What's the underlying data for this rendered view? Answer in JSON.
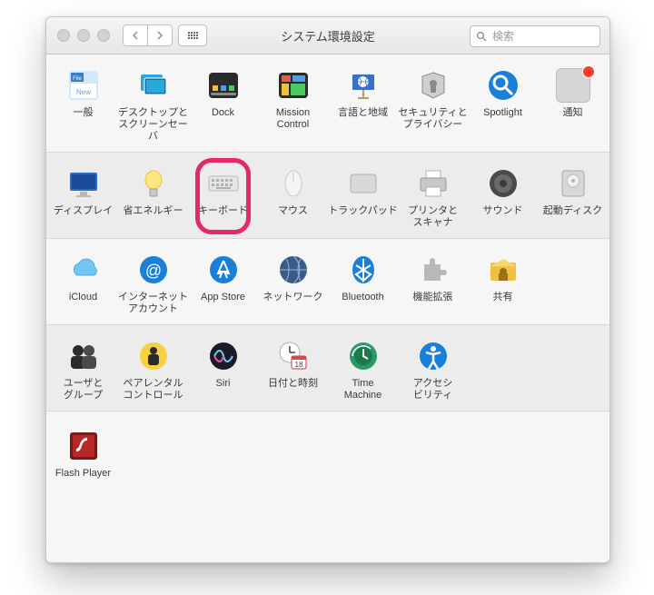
{
  "window": {
    "title": "システム環境設定",
    "search_placeholder": "検索"
  },
  "highlight": {
    "pane": "keyboard",
    "color": "#e6276b"
  },
  "rows": [
    [
      {
        "id": "general",
        "label": "一般"
      },
      {
        "id": "desktop-screensaver",
        "label": "デスクトップと\nスクリーンセーバ"
      },
      {
        "id": "dock",
        "label": "Dock"
      },
      {
        "id": "mission-control",
        "label": "Mission\nControl"
      },
      {
        "id": "language-region",
        "label": "言語と地域"
      },
      {
        "id": "security-privacy",
        "label": "セキュリティと\nプライバシー"
      },
      {
        "id": "spotlight",
        "label": "Spotlight"
      },
      {
        "id": "notifications",
        "label": "通知",
        "badge": true
      }
    ],
    [
      {
        "id": "displays",
        "label": "ディスプレイ"
      },
      {
        "id": "energy-saver",
        "label": "省エネルギー"
      },
      {
        "id": "keyboard",
        "label": "キーボード",
        "highlighted": true
      },
      {
        "id": "mouse",
        "label": "マウス"
      },
      {
        "id": "trackpad",
        "label": "トラックパッド"
      },
      {
        "id": "printers-scanners",
        "label": "プリンタと\nスキャナ"
      },
      {
        "id": "sound",
        "label": "サウンド"
      },
      {
        "id": "startup-disk",
        "label": "起動ディスク"
      }
    ],
    [
      {
        "id": "icloud",
        "label": "iCloud"
      },
      {
        "id": "internet-accounts",
        "label": "インターネット\nアカウント"
      },
      {
        "id": "app-store",
        "label": "App Store"
      },
      {
        "id": "network",
        "label": "ネットワーク"
      },
      {
        "id": "bluetooth",
        "label": "Bluetooth"
      },
      {
        "id": "extensions",
        "label": "機能拡張"
      },
      {
        "id": "sharing",
        "label": "共有"
      }
    ],
    [
      {
        "id": "users-groups",
        "label": "ユーザと\nグループ"
      },
      {
        "id": "parental-controls",
        "label": "ペアレンタル\nコントロール"
      },
      {
        "id": "siri",
        "label": "Siri"
      },
      {
        "id": "date-time",
        "label": "日付と時刻"
      },
      {
        "id": "time-machine",
        "label": "Time\nMachine"
      },
      {
        "id": "accessibility",
        "label": "アクセシ\nビリティ"
      }
    ],
    [
      {
        "id": "flash-player",
        "label": "Flash Player"
      }
    ]
  ]
}
